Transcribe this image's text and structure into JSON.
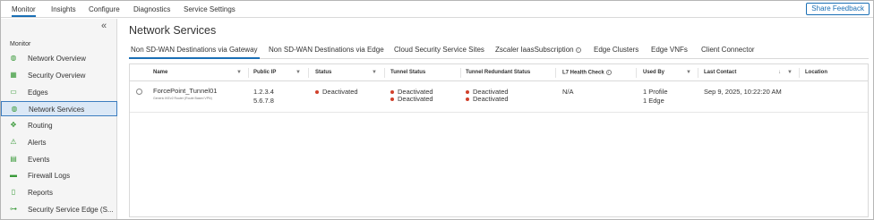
{
  "topnav": {
    "items": [
      "Monitor",
      "Insights",
      "Configure",
      "Diagnostics",
      "Service Settings"
    ],
    "share_label": "Share Feedback"
  },
  "sidebar": {
    "collapse_icon": "double-chevron-left-icon",
    "section_label": "Monitor",
    "items": [
      {
        "label": "Network Overview",
        "icon": "network-overview-icon"
      },
      {
        "label": "Security Overview",
        "icon": "security-overview-icon"
      },
      {
        "label": "Edges",
        "icon": "edges-icon"
      },
      {
        "label": "Network Services",
        "icon": "network-services-icon",
        "active": true
      },
      {
        "label": "Routing",
        "icon": "routing-icon"
      },
      {
        "label": "Alerts",
        "icon": "alerts-icon"
      },
      {
        "label": "Events",
        "icon": "events-icon"
      },
      {
        "label": "Firewall Logs",
        "icon": "firewall-logs-icon"
      },
      {
        "label": "Reports",
        "icon": "reports-icon"
      },
      {
        "label": "Security Service Edge (S...",
        "icon": "sse-icon"
      }
    ]
  },
  "main": {
    "title": "Network Services",
    "tabs": [
      {
        "label": "Non SD-WAN Destinations via Gateway",
        "active": true
      },
      {
        "label": "Non SD-WAN Destinations via Edge"
      },
      {
        "label": "Cloud Security Service Sites"
      },
      {
        "label": "Zscaler IaasSubscription",
        "info": true
      },
      {
        "label": "Edge Clusters"
      },
      {
        "label": "Edge VNFs"
      },
      {
        "label": "Client Connector"
      }
    ]
  },
  "table": {
    "columns": [
      "Name",
      "Public IP",
      "Status",
      "Tunnel Status",
      "Tunnel Redundant Status",
      "L7 Health Check",
      "Used By",
      "Last Contact",
      "Location"
    ],
    "rows": [
      {
        "name": "ForcePoint_Tunnel01",
        "name_sub": "Generic IKEv2 Router (Route Based VPN)",
        "public_ip_1": "1.2.3.4",
        "public_ip_2": "5.6.7.8",
        "status": "Deactivated",
        "tunnel_status_1": "Deactivated",
        "tunnel_status_2": "Deactivated",
        "redundant_status_1": "Deactivated",
        "redundant_status_2": "Deactivated",
        "l7_health": "N/A",
        "used_by_1": "1 Profile",
        "used_by_2": "1 Edge",
        "last_contact": "Sep 9, 2025, 10:22:20 AM",
        "location": ""
      }
    ]
  },
  "colors": {
    "accent": "#1a6fb5",
    "status_red": "#d0402b",
    "active_bg": "#dbe8f6",
    "icon_green": "#3a9a3a"
  }
}
